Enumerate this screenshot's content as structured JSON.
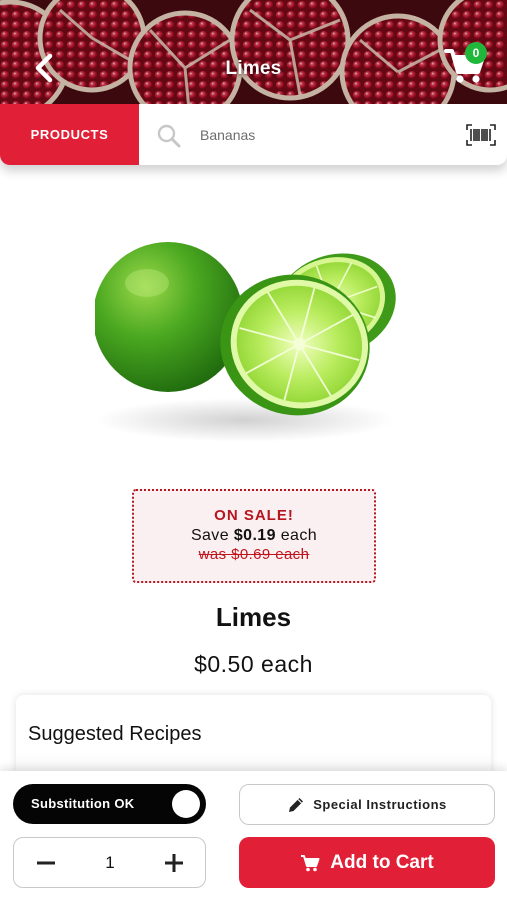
{
  "header": {
    "title": "Limes",
    "cart_count": "0",
    "back_icon": "chevron-left-icon",
    "cart_icon": "shopping-cart-icon"
  },
  "search": {
    "category_button": "PRODUCTS",
    "placeholder": "Bananas",
    "search_icon": "magnifier-icon",
    "barcode_icon": "barcode-icon"
  },
  "product": {
    "name": "Limes",
    "price": "$0.50 each",
    "sale": {
      "heading": "ON SALE!",
      "save_prefix": "Save ",
      "save_amount": "$0.19",
      "save_suffix": " each",
      "was_price": "was $0.69 each"
    }
  },
  "recipes": {
    "title": "Suggested Recipes"
  },
  "actions": {
    "substitution_label": "Substitution OK",
    "substitution_on": true,
    "special_instructions_label": "Special Instructions",
    "quantity": "1",
    "add_to_cart_label": "Add to Cart"
  },
  "colors": {
    "brand_red": "#e11f36",
    "sale_red": "#b5161f",
    "badge_green": "#1fb83b",
    "toggle_black": "#050505"
  }
}
